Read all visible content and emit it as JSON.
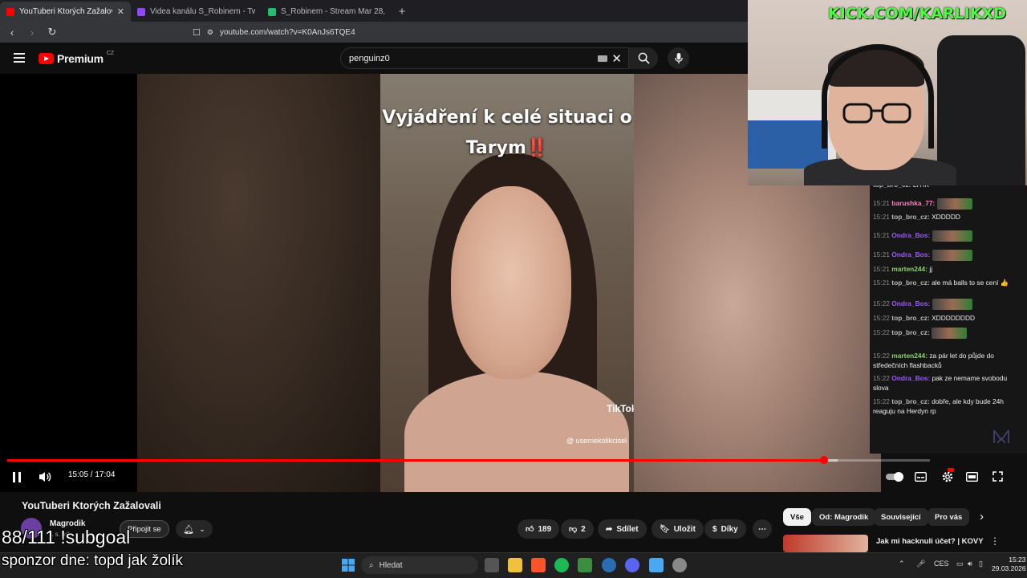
{
  "browser": {
    "tabs": [
      {
        "title": "YouTuberi Ktorých Zažalovali",
        "active": true,
        "color": "#ff0000"
      },
      {
        "title": "Videa kanálu S_Robinem - Twitch",
        "active": false,
        "color": "#9146ff"
      },
      {
        "title": "S_Robinem - Stream Mar 28, 2026 - S",
        "active": false,
        "color": "#1dbf73"
      }
    ],
    "url": "youtube.com/watch?v=K0AnJs6TQE4"
  },
  "youtube": {
    "logo": "Premium",
    "region": "CZ",
    "search_value": "penguinz0"
  },
  "video": {
    "caption_line1": "Vyjádření k celé situaci o",
    "caption_line2": "Tarym‼️",
    "tiktok_label": "TikTok",
    "tiktok_user": "@ usernekolikcisel",
    "time": "15:05 / 17:04",
    "progress": 0.885,
    "buffered": 0.9
  },
  "info": {
    "title": "YouTuberi Ktorých Zažalovali",
    "channel": "Magrodik",
    "subs": "1 s. od.",
    "join": "Připojit se",
    "likes": "189",
    "dislikes": "2",
    "share": "Sdílet",
    "save": "Uložit",
    "thanks": "Díky",
    "more": "⋯"
  },
  "chips": [
    "Vše",
    "Od: Magrodik",
    "Související",
    "Pro vás"
  ],
  "rec": {
    "title": "Jak mi hacknuli účet? | KOVY"
  },
  "overlay": {
    "subgoal": "88/111 !subgoal",
    "sponsor": "sponzor dne: topd jak žolík"
  },
  "webcam": {
    "kick": "KICK.COM/KARLIKXD"
  },
  "chat": [
    {
      "time": "",
      "user": "top_bro_cz:",
      "color": "#b9b9b9",
      "text": "LITIK",
      "emote": false
    },
    {
      "time": "15:21",
      "user": "barushka_77:",
      "color": "#ff7fbf",
      "text": "",
      "emote": true
    },
    {
      "time": "15:21",
      "user": "top_bro_cz:",
      "color": "#b9b9b9",
      "text": "XDDDDD",
      "emote": false
    },
    {
      "time": "15:21",
      "user": "Ondra_Bos:",
      "color": "#9b59ff",
      "text": "",
      "emote": true
    },
    {
      "time": "15:21",
      "user": "Ondra_Bos:",
      "color": "#9b59ff",
      "text": "",
      "emote": true
    },
    {
      "time": "15:21",
      "user": "marten244:",
      "color": "#8ed26e",
      "text": "jj",
      "emote": false
    },
    {
      "time": "15:21",
      "user": "top_bro_cz:",
      "color": "#b9b9b9",
      "text": "ale má balls to se cení 👍",
      "emote": false
    },
    {
      "time": "15:22",
      "user": "Ondra_Bos:",
      "color": "#9b59ff",
      "text": "",
      "emote": true
    },
    {
      "time": "15:22",
      "user": "top_bro_cz:",
      "color": "#b9b9b9",
      "text": "XDDDDDDDD",
      "emote": false
    },
    {
      "time": "15:22",
      "user": "top_bro_cz:",
      "color": "#b9b9b9",
      "text": "",
      "emote": true
    },
    {
      "time": "15:22",
      "user": "marten244:",
      "color": "#8ed26e",
      "text": "za pár let do půjde do středečních flashbacků",
      "emote": false
    },
    {
      "time": "15:22",
      "user": "Ondra_Bos:",
      "color": "#9b59ff",
      "text": "pak ze nemame svobodu slova",
      "emote": false
    },
    {
      "time": "15:22",
      "user": "top_bro_cz:",
      "color": "#b9b9b9",
      "text": "dobře, ale kdy bude 24h reaguju na Herdyn rp",
      "emote": false
    }
  ],
  "taskbar": {
    "search": "Hledat",
    "lang": "CES",
    "time": "15:23",
    "date": "29.03.2026"
  }
}
